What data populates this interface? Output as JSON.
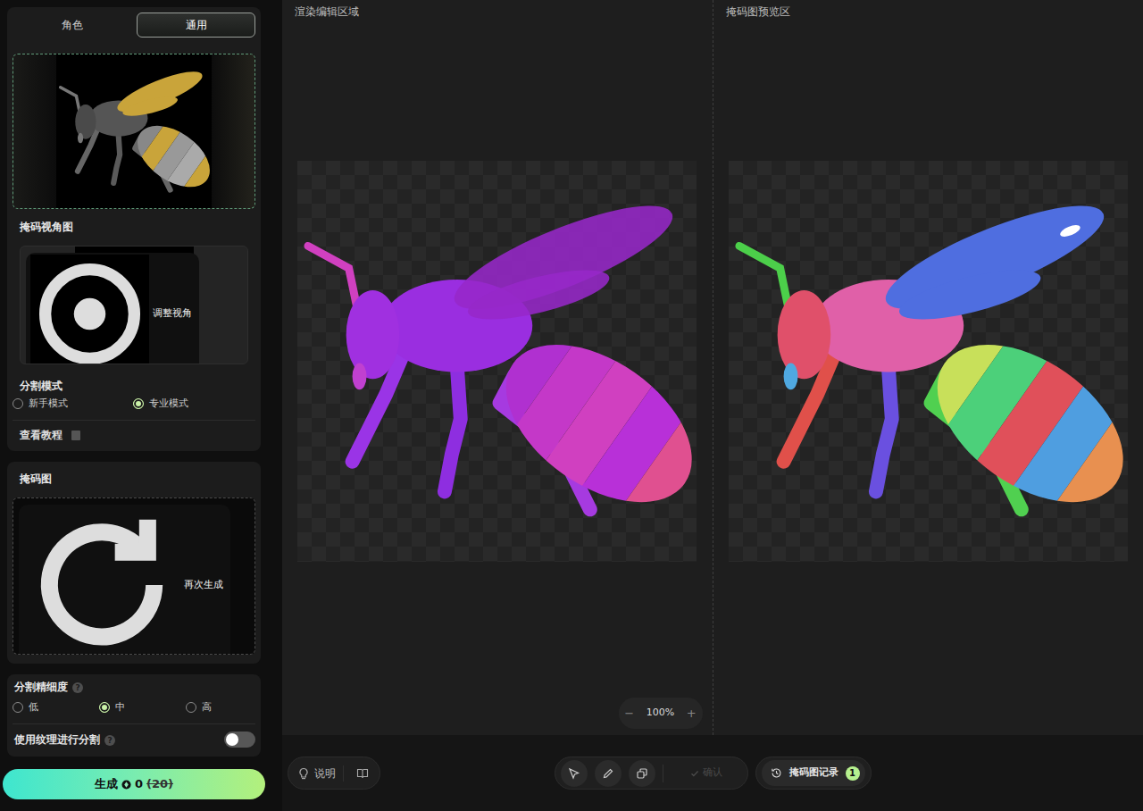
{
  "sidebar": {
    "tabs": [
      {
        "label": "角色",
        "selected": false
      },
      {
        "label": "通用",
        "selected": true
      }
    ],
    "mask_view": {
      "title": "掩码视角图",
      "adjust_button": "调整视角"
    },
    "split_mode": {
      "title": "分割模式",
      "options": [
        {
          "label": "新手模式",
          "selected": false
        },
        {
          "label": "专业模式",
          "selected": true
        }
      ]
    },
    "tutorial": "查看教程",
    "mask": {
      "title": "掩码图",
      "regenerate_button": "再次生成"
    },
    "precision": {
      "title": "分割精细度",
      "help": "?",
      "options": [
        {
          "label": "低",
          "selected": false
        },
        {
          "label": "中",
          "selected": true
        },
        {
          "label": "高",
          "selected": false
        }
      ]
    },
    "texture_toggle": {
      "label": "使用纹理进行分割",
      "help": "?",
      "on": false
    },
    "generate": {
      "label": "生成",
      "cost": "0",
      "original_cost": "(20)"
    }
  },
  "panels": [
    {
      "title": "渲染编辑区域"
    },
    {
      "title": "掩码图预览区"
    }
  ],
  "zoom": {
    "minus": "−",
    "value": "100%",
    "plus": "+"
  },
  "toolbar": {
    "help_button": "说明",
    "confirm": {
      "label": "确认",
      "disabled": true
    },
    "history": {
      "label": "掩码图记录",
      "count": "1"
    }
  }
}
